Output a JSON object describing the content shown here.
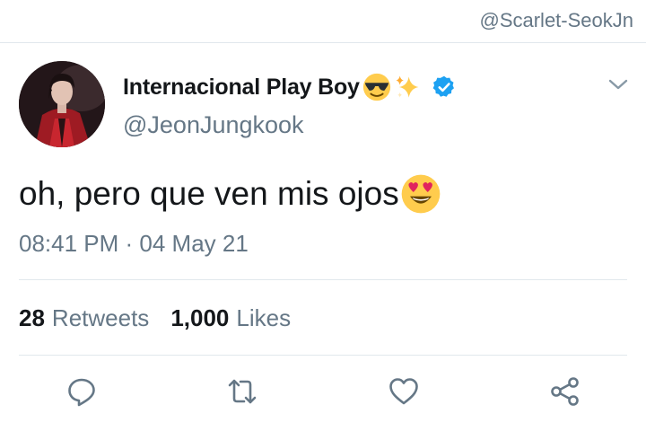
{
  "watermark": "@Scarlet-SeokJn",
  "tweet": {
    "display_name": "Internacional Play Boy",
    "handle": "@JeonJungkook",
    "text": "oh, pero que ven mis ojos",
    "time": "08:41 PM",
    "separator": " · ",
    "date": "04 May 21",
    "name_emojis": [
      "sunglasses-emoji",
      "sparkles-emoji"
    ],
    "text_emoji": "heart-eyes-emoji",
    "verified": true
  },
  "stats": {
    "retweets_count": "28",
    "retweets_label": "Retweets",
    "likes_count": "1,000",
    "likes_label": "Likes"
  },
  "actions": [
    "reply-icon",
    "retweet-icon",
    "like-icon",
    "share-icon"
  ],
  "colors": {
    "text_primary": "#14171a",
    "text_secondary": "#657786",
    "divider": "#e1e8ed",
    "verified_blue": "#1da1f2",
    "icon_gray": "#657786",
    "emoji_yellow": "#ffcc4d"
  }
}
